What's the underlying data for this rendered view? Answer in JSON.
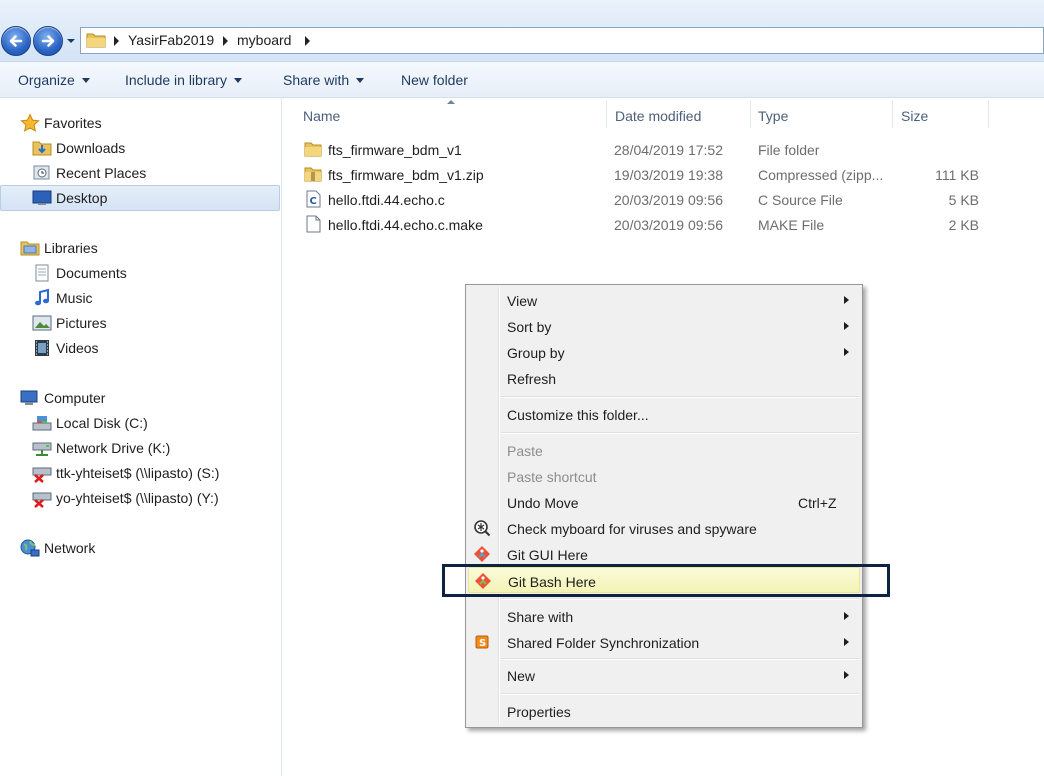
{
  "address": {
    "crumbs": [
      "YasirFab2019",
      "myboard"
    ]
  },
  "toolbar": {
    "organize": "Organize",
    "include_in_library": "Include in library",
    "share_with": "Share with",
    "new_folder": "New folder"
  },
  "nav": {
    "favorites": "Favorites",
    "downloads": "Downloads",
    "recent_places": "Recent Places",
    "desktop": "Desktop",
    "libraries": "Libraries",
    "documents": "Documents",
    "music": "Music",
    "pictures": "Pictures",
    "videos": "Videos",
    "computer": "Computer",
    "local_disk": "Local Disk (C:)",
    "network_drive": "Network Drive (K:)",
    "ttk": "ttk-yhteiset$ (\\\\lipasto) (S:)",
    "yo": "yo-yhteiset$ (\\\\lipasto) (Y:)",
    "network": "Network"
  },
  "columns": {
    "name": "Name",
    "date_modified": "Date modified",
    "type": "Type",
    "size": "Size"
  },
  "files": [
    {
      "name": "fts_firmware_bdm_v1",
      "date": "28/04/2019 17:52",
      "type": "File folder",
      "size": ""
    },
    {
      "name": "fts_firmware_bdm_v1.zip",
      "date": "19/03/2019 19:38",
      "type": "Compressed (zipp...",
      "size": "111 KB"
    },
    {
      "name": "hello.ftdi.44.echo.c",
      "date": "20/03/2019 09:56",
      "type": "C Source File",
      "size": "5 KB"
    },
    {
      "name": "hello.ftdi.44.echo.c.make",
      "date": "20/03/2019 09:56",
      "type": "MAKE File",
      "size": "2 KB"
    }
  ],
  "menu": {
    "view": "View",
    "sort_by": "Sort by",
    "group_by": "Group by",
    "refresh": "Refresh",
    "customize": "Customize this folder...",
    "paste": "Paste",
    "paste_shortcut": "Paste shortcut",
    "undo_move": "Undo Move",
    "undo_shortcut": "Ctrl+Z",
    "check_viruses": "Check myboard for viruses and spyware",
    "git_gui": "Git GUI Here",
    "git_bash": "Git Bash Here",
    "share_with": "Share with",
    "shared_sync": "Shared Folder Synchronization",
    "new": "New",
    "properties": "Properties"
  },
  "colors": {
    "highlight_box": "#0e2342",
    "menu_hover": "#f3f3b6",
    "git_orange": "#f05033"
  }
}
